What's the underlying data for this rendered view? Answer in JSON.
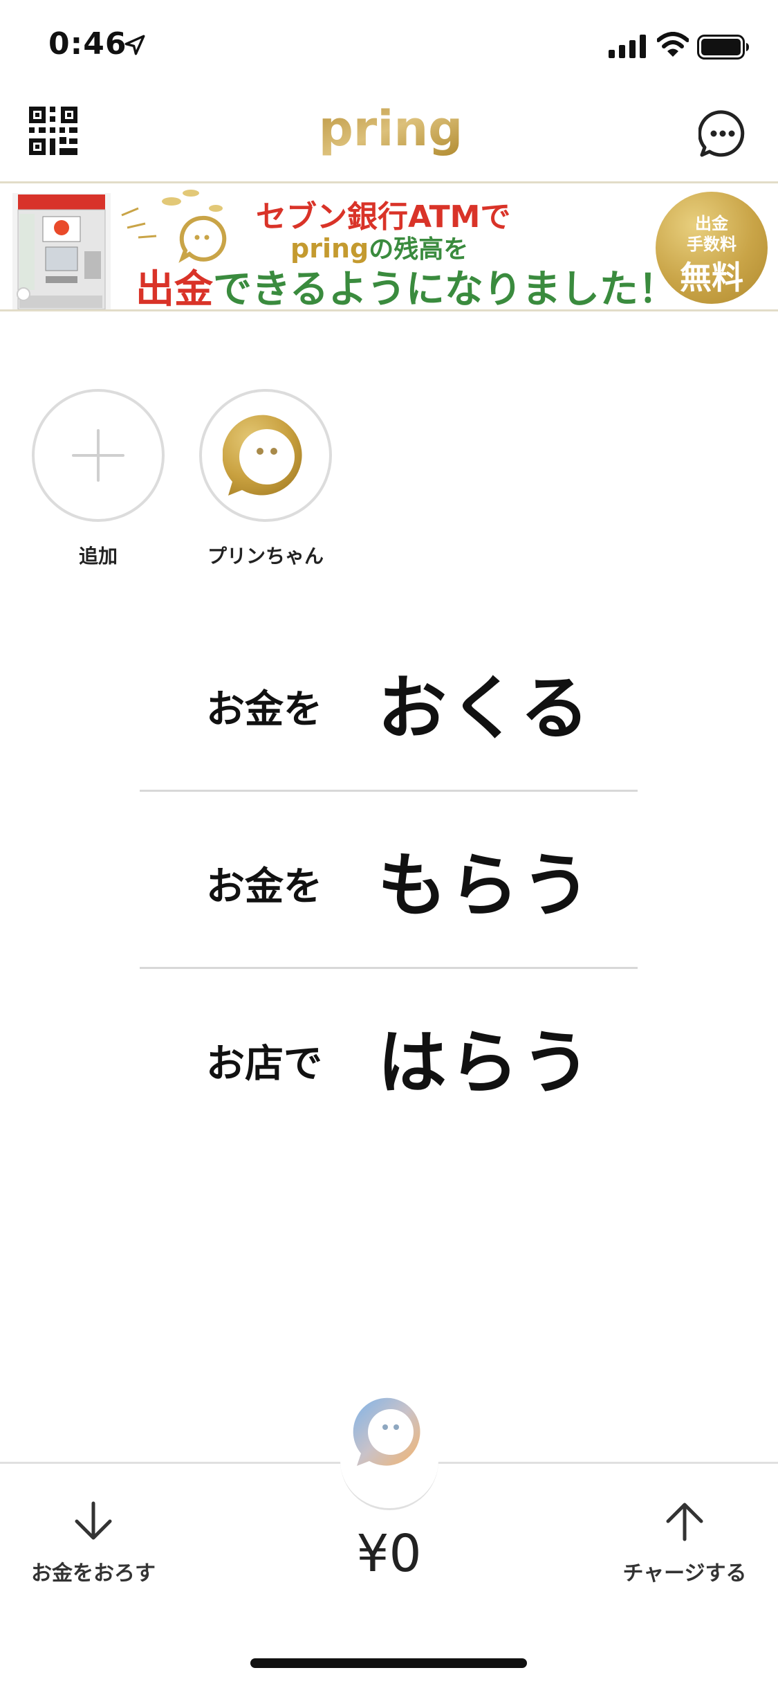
{
  "status_bar": {
    "time": "0:46"
  },
  "header": {
    "logo_text": "pring"
  },
  "banner": {
    "line1": "セブン銀行ATMで",
    "line2_brand": "pring",
    "line2_rest": "の残高を",
    "line3_red": "出金",
    "line3_rest": "できるようになりました！",
    "badge": {
      "line1": "出金",
      "line2": "手数料",
      "line3": "無料"
    }
  },
  "contacts": [
    {
      "label": "追加",
      "icon": "plus-icon"
    },
    {
      "label": "プリンちゃん",
      "icon": "pudding-avatar"
    }
  ],
  "actions": [
    {
      "small": "お金を",
      "big": "おくる"
    },
    {
      "small": "お金を",
      "big": "もらう"
    },
    {
      "small": "お店で",
      "big": "はらう"
    }
  ],
  "bottom_bar": {
    "withdraw_label": "お金をおろす",
    "balance": "¥0",
    "charge_label": "チャージする"
  },
  "colors": {
    "gold": "#c9a447",
    "banner_red": "#d93328",
    "banner_green": "#3a8b3e",
    "divider": "#d8d8d8"
  }
}
